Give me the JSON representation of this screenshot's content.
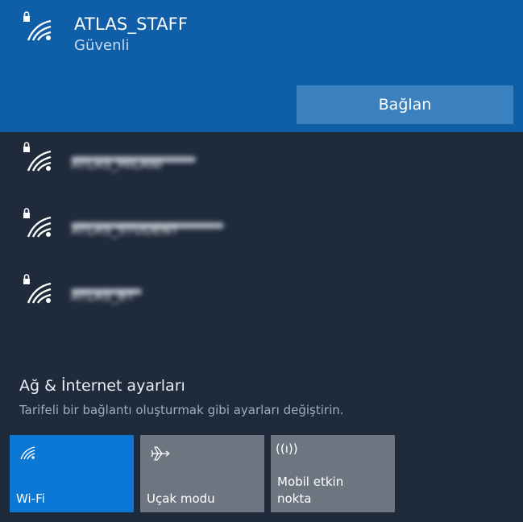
{
  "selected_network": {
    "name": "ATLAS_STAFF",
    "status": "Güvenli",
    "connect_label": "Bağlan"
  },
  "networks": [
    {
      "name": "ATLAS_MILANI"
    },
    {
      "name": "ATLAS_STUDENT"
    },
    {
      "name": "ATLAS_BT"
    }
  ],
  "settings": {
    "link": "Ağ & İnternet ayarları",
    "description": "Tarifeli bir bağlantı oluşturmak gibi ayarları değiştirin."
  },
  "quick_actions": [
    {
      "label": "Wi-Fi",
      "icon": "wifi-icon",
      "active": true
    },
    {
      "label": "Uçak modu",
      "icon": "airplane-icon",
      "active": false
    },
    {
      "label": "Mobil etkin nokta",
      "icon": "hotspot-icon",
      "active": false,
      "icon_glyph": "((ı))"
    }
  ],
  "colors": {
    "selected_bg": "#0f5ea8",
    "panel_bg": "#1f2a3b",
    "active_tile": "#0b78d6",
    "inactive_tile": "#6d7680"
  }
}
